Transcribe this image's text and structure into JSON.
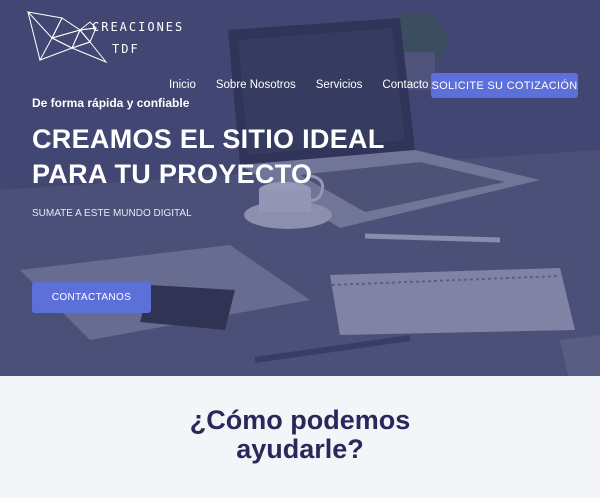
{
  "brand": {
    "line1": "CREACIONES",
    "line2": "TDF"
  },
  "nav": {
    "items": [
      {
        "label": "Inicio"
      },
      {
        "label": "Sobre Nosotros"
      },
      {
        "label": "Servicios"
      },
      {
        "label": "Contacto"
      }
    ],
    "cta_label": "SOLICITE SU COTIZACIÓN"
  },
  "hero": {
    "tagline": "De forma rápida y confiable",
    "headline_line1": "CREAMOS EL SITIO IDEAL",
    "headline_line2": "PARA TU PROYECTO",
    "subtext": "SUMATE A ESTE MUNDO DIGITAL",
    "button_label": "CONTACTANOS"
  },
  "section": {
    "title_line1": "¿Cómo podemos",
    "title_line2": "ayudarle?"
  },
  "colors": {
    "accent": "#5d6fd8",
    "hero_overlay": "#3f4470",
    "section_bg": "#f4f5f9",
    "title": "#26295a"
  }
}
